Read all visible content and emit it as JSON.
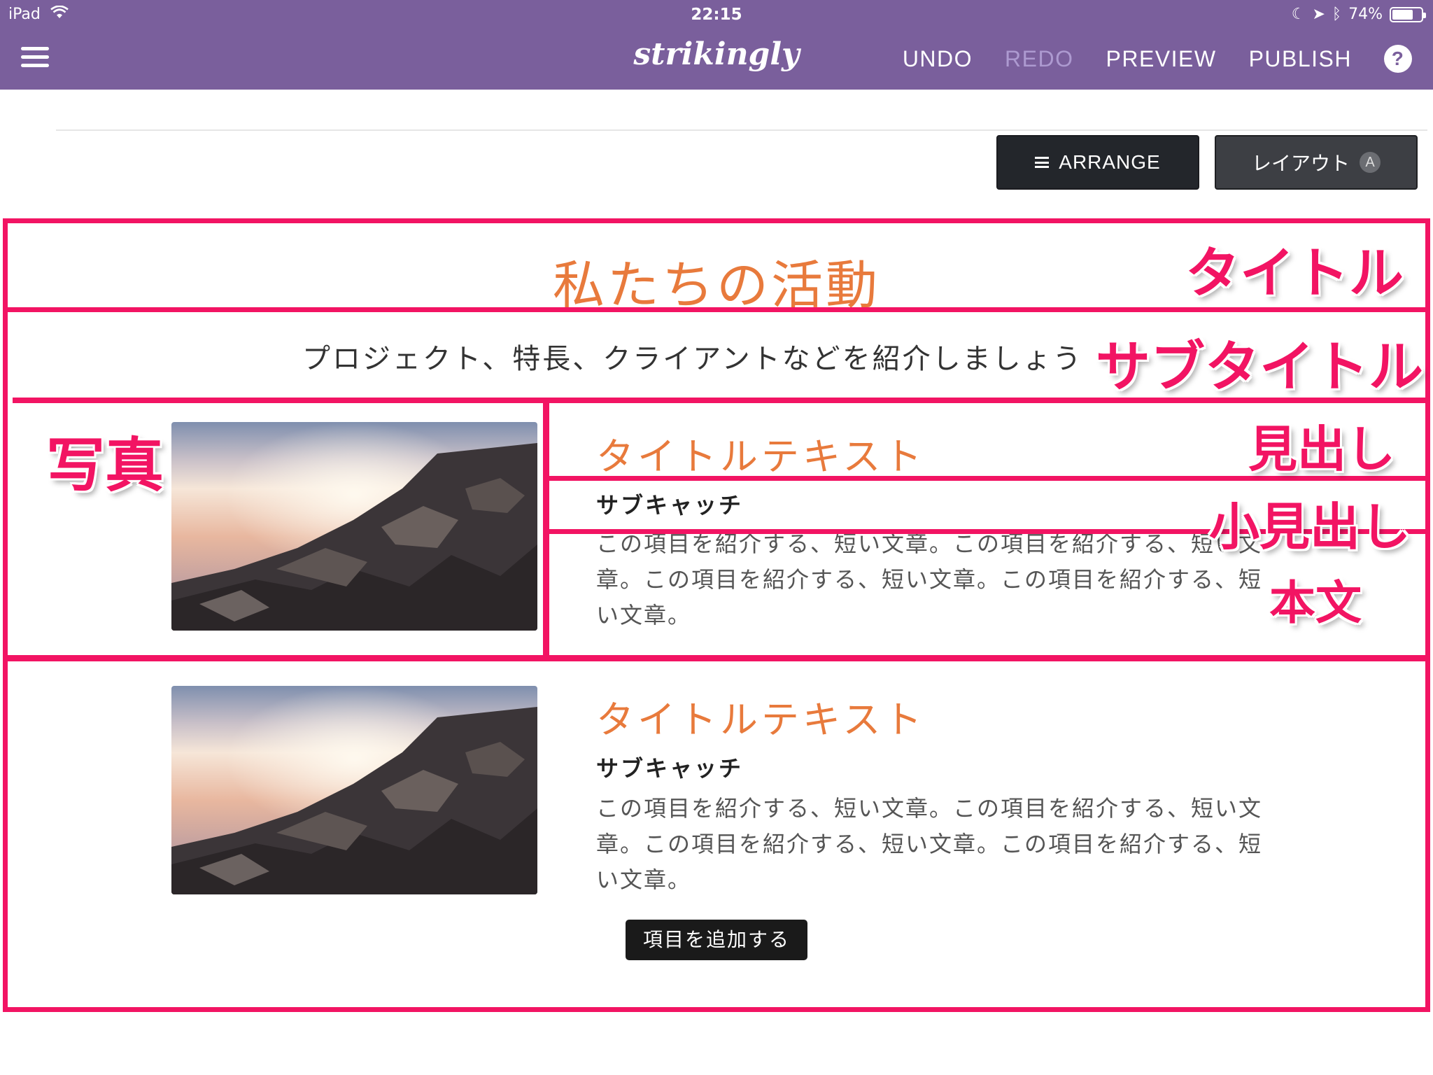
{
  "status_bar": {
    "carrier": "iPad",
    "time": "22:15",
    "battery": "74%",
    "battery_level": 0.74
  },
  "toolbar": {
    "logo": "strikingly",
    "undo": "UNDO",
    "redo": "REDO",
    "preview": "PREVIEW",
    "publish": "PUBLISH",
    "help": "?"
  },
  "actions": {
    "arrange": "ARRANGE",
    "layout": "レイアウト",
    "layout_badge": "A"
  },
  "section": {
    "title": "私たちの活動",
    "subtitle": "プロジェクト、特長、クライアントなどを紹介しましょう",
    "items": [
      {
        "title": "タイトルテキスト",
        "catch": "サブキャッチ",
        "body": "この項目を紹介する、短い文章。この項目を紹介する、短い文章。この項目を紹介する、短い文章。この項目を紹介する、短い文章。"
      },
      {
        "title": "タイトルテキスト",
        "catch": "サブキャッチ",
        "body": "この項目を紹介する、短い文章。この項目を紹介する、短い文章。この項目を紹介する、短い文章。この項目を紹介する、短い文章。"
      }
    ],
    "add_button": "項目を追加する"
  },
  "annotations": {
    "title": "タイトル",
    "subtitle": "サブタイトル",
    "photo": "写真",
    "heading": "見出し",
    "subheading": "小見出し",
    "body": "本文"
  },
  "colors": {
    "toolbar": "#7a5f9c",
    "accent_orange": "#e87a3c",
    "annotation_pink": "#f21463"
  }
}
